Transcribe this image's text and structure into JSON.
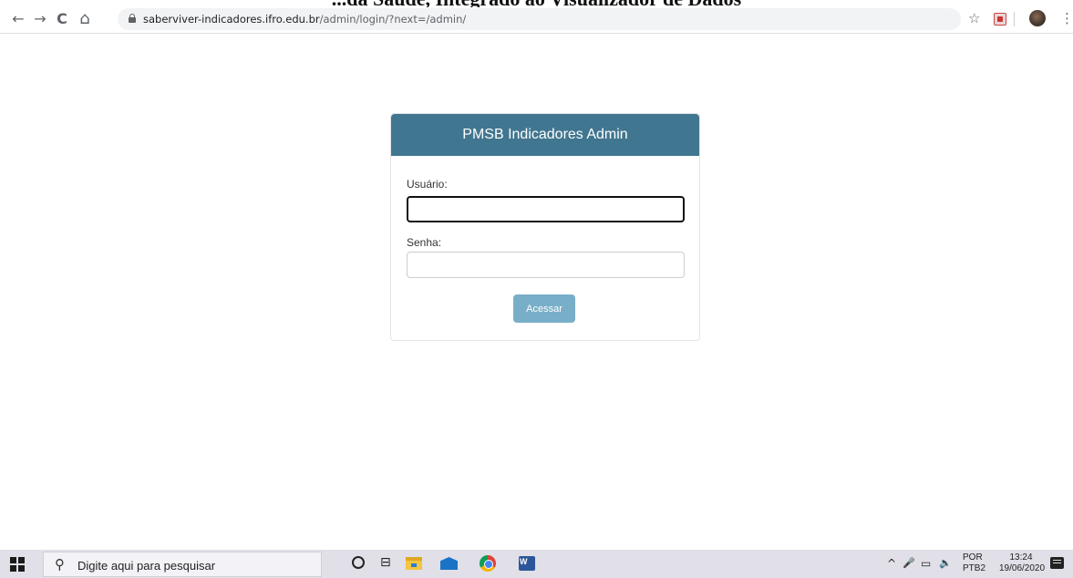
{
  "caption": "...da Saúde, Integrado ao Visualizador de Dados",
  "browser": {
    "back_glyph": "←",
    "forward_glyph": "→",
    "reload_glyph": "C",
    "home_glyph": "⌂",
    "url_host": "saberviver-indicadores.ifro.edu.br",
    "url_path": "/admin/login/?next=/admin/",
    "star_glyph": "☆",
    "menu_glyph": "⋮"
  },
  "login": {
    "header_title": "PMSB Indicadores Admin",
    "username_label": "Usuário:",
    "username_value": "",
    "password_label": "Senha:",
    "password_value": "",
    "submit_label": "Acessar",
    "header_color": "#417690",
    "button_color": "#79aec8"
  },
  "taskbar": {
    "search_placeholder": "Digite aqui para pesquisar",
    "search_glyph": "⚲",
    "taskview_glyph": "⊟",
    "tray_chevron": "^",
    "tray_mic": "🎤",
    "tray_network": "▭",
    "tray_volume": "🔈",
    "lang_top": "POR",
    "lang_bottom": "PTB2",
    "time": "13:24",
    "date": "19/06/2020"
  }
}
